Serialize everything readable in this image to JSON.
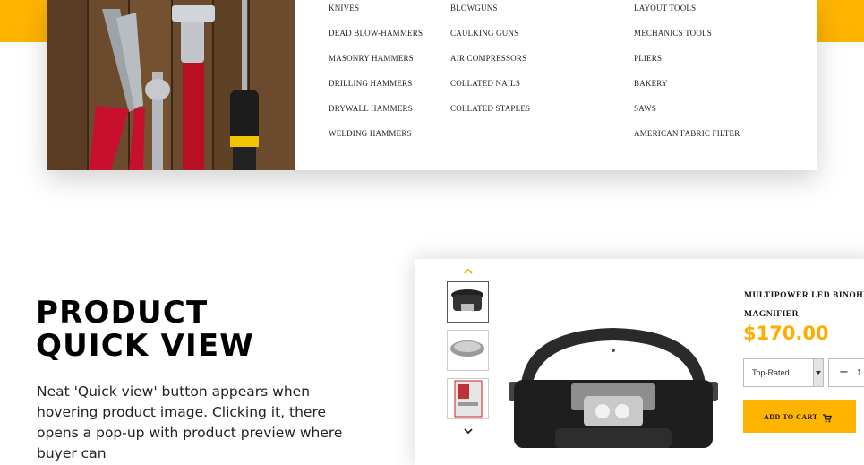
{
  "menu": {
    "columns": [
      [
        "KNIVES",
        "DEAD BLOW-HAMMERS",
        "MASONRY HAMMERS",
        "DRILLING HAMMERS",
        "DRYWALL HAMMERS",
        "WELDING HAMMERS"
      ],
      [
        "BLOWGUNS",
        "CAULKING GUNS",
        "AIR COMPRESSORS",
        "COLLATED NAILS",
        "COLLATED STAPLES"
      ],
      [
        "LAYOUT TOOLS",
        "MECHANICS TOOLS",
        "PLIERS",
        "BAKERY",
        "SAWS",
        "AMERICAN FABRIC FILTER"
      ]
    ]
  },
  "feature": {
    "title_line1": "PRODUCT",
    "title_line2": "QUICK VIEW",
    "description": "Neat 'Quick view' button appears when hovering product image. Clicking it, there opens a pop-up with product preview where buyer can"
  },
  "quick_view": {
    "product_name_line1": "MULTIPOWER LED BINOHEAD",
    "product_name_line2": "MAGNIFIER",
    "price": "$170.00",
    "sort_select": "Top-Rated",
    "quantity": "1",
    "quantity_minus": "−",
    "add_to_cart": "ADD TO CART"
  },
  "colors": {
    "accent": "#ffb400",
    "price": "#ffae00"
  },
  "icons": [
    "chevron-up-icon",
    "chevron-down-icon",
    "cart-icon",
    "select-arrow-icon"
  ]
}
